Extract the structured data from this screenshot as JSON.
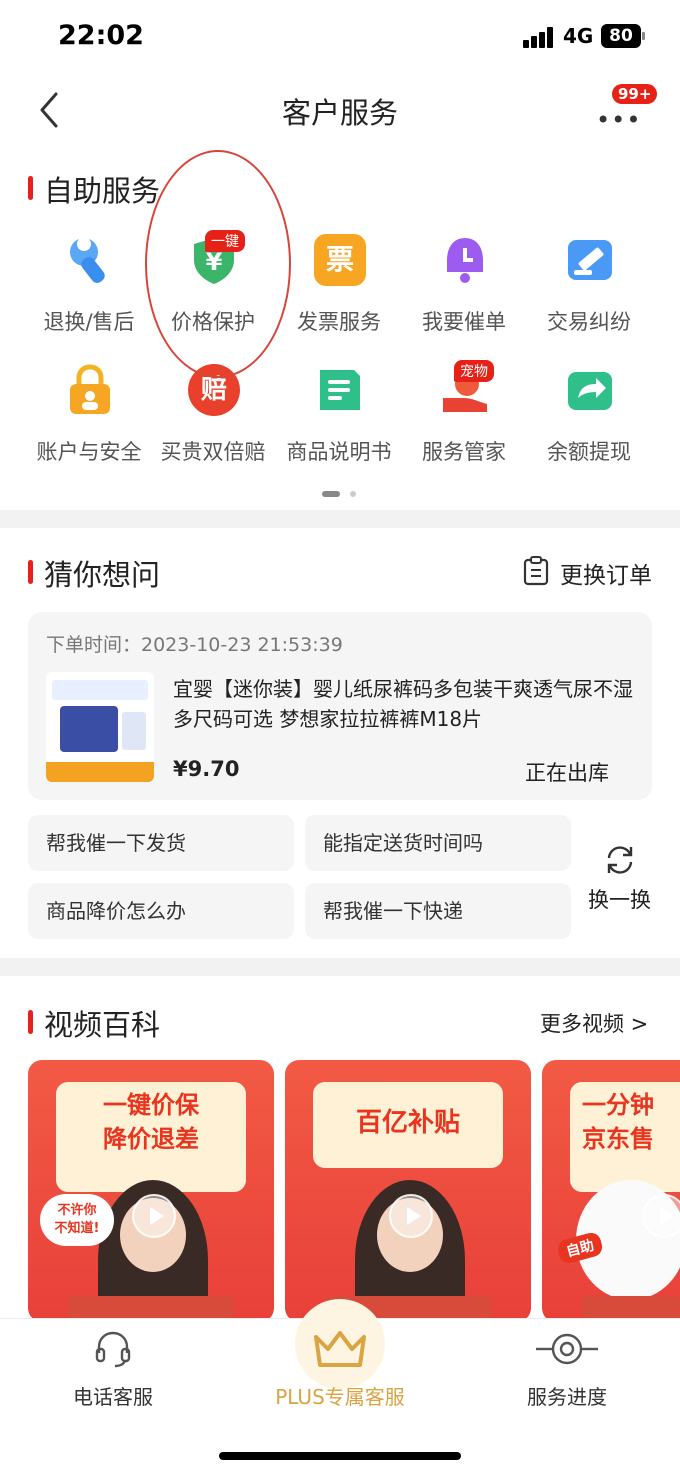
{
  "status": {
    "time": "22:02",
    "network": "4G",
    "battery": "80"
  },
  "nav": {
    "title": "客户服务",
    "badge": "99+"
  },
  "self_service": {
    "title": "自助服务",
    "items": [
      {
        "label": "退换/售后",
        "icon": "wrench-icon"
      },
      {
        "label": "价格保护",
        "icon": "price-shield-icon",
        "badge": "一键"
      },
      {
        "label": "发票服务",
        "icon": "invoice-icon",
        "glyph": "票"
      },
      {
        "label": "我要催单",
        "icon": "bell-clock-icon"
      },
      {
        "label": "交易纠纷",
        "icon": "gavel-icon"
      },
      {
        "label": "账户与安全",
        "icon": "lock-icon"
      },
      {
        "label": "买贵双倍赔",
        "icon": "compensation-medal-icon",
        "glyph": "赔"
      },
      {
        "label": "商品说明书",
        "icon": "manual-icon"
      },
      {
        "label": "服务管家",
        "icon": "butler-hand-icon",
        "badge": "宠物"
      },
      {
        "label": "余额提现",
        "icon": "wallet-withdraw-icon"
      }
    ]
  },
  "guess": {
    "title": "猜你想问",
    "change_order": "更换订单",
    "order": {
      "time": "下单时间：2023-10-23 21:53:39",
      "name": "宜婴【迷你装】婴儿纸尿裤码多包装干爽透气尿不湿 多尺码可选 梦想家拉拉裤裤M18片",
      "price": "¥9.70",
      "status": "正在出库"
    },
    "questions": [
      "帮我催一下发货",
      "能指定送货时间吗",
      "商品降价怎么办",
      "帮我催一下快递"
    ],
    "refresh": "换一换"
  },
  "videos": {
    "title": "视频百科",
    "more": "更多视频 >",
    "cards": [
      {
        "line1": "一键价保",
        "line2": "降价退差",
        "sticker": "不许你\n不知道!"
      },
      {
        "line1": "百亿补贴",
        "line2": ""
      },
      {
        "line1": "一分钟",
        "line2": "京东售",
        "sticker": "自助"
      }
    ]
  },
  "tabs": [
    {
      "label": "电话客服",
      "icon": "headset-icon"
    },
    {
      "label": "PLUS专属客服",
      "icon": "crown-icon"
    },
    {
      "label": "服务进度",
      "icon": "progress-icon"
    }
  ],
  "colors": {
    "accent": "#e62117",
    "plus": "#d9a441"
  }
}
